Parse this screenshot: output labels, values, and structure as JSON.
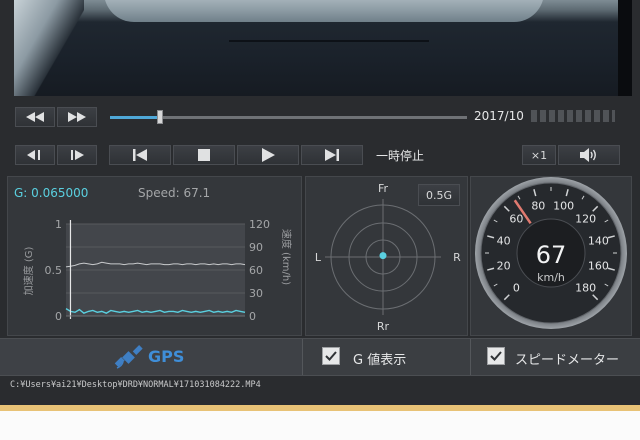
{
  "playback": {
    "datetime": "2017/10",
    "status": "一時停止",
    "speed_multiplier": "×1",
    "seek_fraction": 0.14
  },
  "g_panel": {
    "g_readout": "G: 0.065000",
    "speed_readout": "Speed: 67.1",
    "left_axis_label": "加速度 (G)",
    "right_axis_label": "速度 (km/h)"
  },
  "chart_data": {
    "type": "line",
    "x": [
      0,
      1,
      2,
      3,
      4,
      5,
      6,
      7,
      8,
      9,
      10,
      11,
      12,
      13,
      14,
      15,
      16,
      17,
      18,
      19,
      20,
      21,
      22,
      23,
      24,
      25,
      26,
      27,
      28,
      29,
      30,
      31,
      32,
      33,
      34,
      35,
      36,
      37,
      38,
      39,
      40
    ],
    "series": [
      {
        "name": "加速度",
        "axis": "left",
        "values": [
          0.08,
          0.05,
          0.04,
          0.07,
          0.03,
          0.05,
          0.06,
          0.04,
          0.05,
          0.03,
          0.06,
          0.05,
          0.04,
          0.05,
          0.04,
          0.05,
          0.06,
          0.04,
          0.05,
          0.04,
          0.05,
          0.06,
          0.04,
          0.05,
          0.05,
          0.04,
          0.06,
          0.05,
          0.04,
          0.05,
          0.04,
          0.05,
          0.06,
          0.04,
          0.05,
          0.04,
          0.05,
          0.04,
          0.06,
          0.05,
          0.04
        ]
      },
      {
        "name": "速度",
        "axis": "right",
        "values": [
          64,
          65,
          66,
          68,
          69,
          68,
          67,
          68,
          70,
          69,
          68,
          68,
          68,
          67,
          68,
          68,
          69,
          68,
          67,
          68,
          68,
          68,
          67,
          67,
          68,
          68,
          67,
          68,
          68,
          67,
          68,
          68,
          67,
          68,
          67,
          68,
          68,
          67,
          68,
          68,
          67
        ]
      }
    ],
    "left_ylim": [
      0,
      1
    ],
    "left_ticks": [
      "1",
      "0.5",
      "0"
    ],
    "right_ylim": [
      0,
      120
    ],
    "right_ticks": [
      "120",
      "90",
      "60",
      "30",
      "0"
    ],
    "cursor_x": 1,
    "grid": true
  },
  "radar": {
    "top": "Fr",
    "bottom": "Rr",
    "left": "L",
    "right": "R",
    "scale_label": "0.5G",
    "point": {
      "lateral_g": 0.0,
      "longitudinal_g": 0.02
    }
  },
  "speedometer": {
    "value": "67",
    "unit": "km/h",
    "needle_value": 67,
    "min": 0,
    "max": 180,
    "tick_labels": [
      "0",
      "20",
      "40",
      "60",
      "80",
      "100",
      "120",
      "140",
      "160",
      "180"
    ]
  },
  "footer": {
    "gps_label": "GPS",
    "g_display_label": "G 値表示",
    "speedometer_label": "スピードメーター",
    "g_display_checked": true,
    "speedometer_checked": true
  },
  "file_path": "C:¥Users¥ai21¥Desktop¥DRD¥NORMAL¥171031084222.MP4",
  "colors": {
    "accent": "#4fa8d8",
    "graph_line_g": "#5ad0e0",
    "graph_line_speed": "#c8cacc"
  }
}
